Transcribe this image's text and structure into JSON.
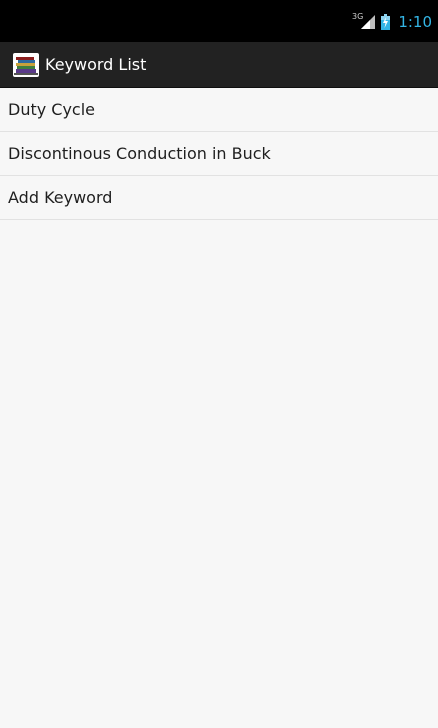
{
  "status_bar": {
    "network_type": "3G",
    "time": "1:10",
    "icons": [
      "signal-icon",
      "battery-charging-icon"
    ]
  },
  "action_bar": {
    "title": "Keyword List",
    "icon": "books-app-icon"
  },
  "keywords": [
    {
      "label": "Duty Cycle"
    },
    {
      "label": "Discontinous Conduction in Buck"
    },
    {
      "label": "Add Keyword"
    }
  ],
  "colors": {
    "status_bar_bg": "#000000",
    "action_bar_bg": "#222222",
    "clock": "#33b5e5",
    "list_bg": "#f7f7f7",
    "divider": "#e2e2e2"
  }
}
